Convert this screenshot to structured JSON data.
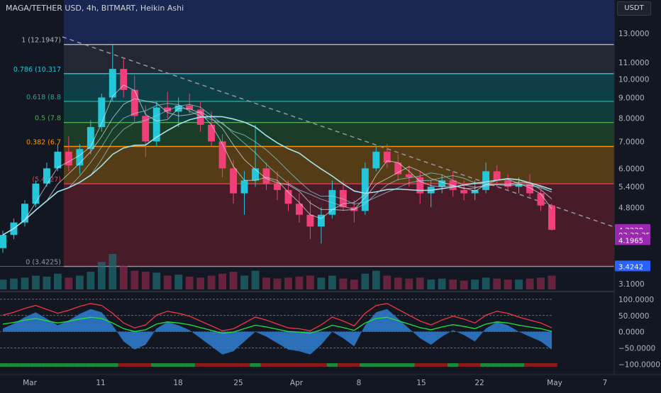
{
  "header": {
    "title": "MAGA/TETHER USD, 4h, BITMART, Heikin Ashi",
    "currency_button": "USDT"
  },
  "chart_data": [
    {
      "type": "candlestick",
      "title": "MAGA/TETHER USD, 4h, BITMART, Heikin Ashi",
      "scale": "log",
      "ylim": [
        3.0,
        14.5
      ],
      "y_ticks": [
        "13.0000",
        "11.0000",
        "10.0000",
        "9.0000",
        "8.0000",
        "7.0000",
        "6.0000",
        "5.4000",
        "4.8000",
        "3.1000"
      ],
      "y_tick_values": [
        13.0,
        11.0,
        10.0,
        9.0,
        8.0,
        7.0,
        6.0,
        5.4,
        4.8,
        3.1
      ],
      "x_ticks": [
        "Mar",
        "11",
        "18",
        "25",
        "Apr",
        "8",
        "15",
        "22",
        "May",
        "7"
      ],
      "fib_levels": [
        {
          "label": "1 (12.1947)",
          "value": 12.1947,
          "color": "#b2b5be"
        },
        {
          "label": "0.786 (10.317",
          "value": 10.317,
          "color": "#26c6da"
        },
        {
          "label": "0.618 (8.8",
          "value": 8.8,
          "color": "#26a69a"
        },
        {
          "label": "0.5 (7.8",
          "value": 7.8,
          "color": "#4caf50"
        },
        {
          "label": "0.382 (6.7",
          "value": 6.8,
          "color": "#ff9800"
        },
        {
          "label": "(5.4927)",
          "value": 5.4927,
          "color": "#f23645"
        },
        {
          "label": "0 (3.4225)",
          "value": 3.4225,
          "color": "#9598a1"
        }
      ],
      "price_labels": [
        {
          "text": "4.2220",
          "value": 4.222,
          "color": "#9c27b0"
        },
        {
          "text": "03:32:35",
          "value": 4.1,
          "color": "#9c27b0"
        },
        {
          "text": "4.1965",
          "value": 3.98,
          "color": "#9c27b0"
        },
        {
          "text": "3.4242",
          "value": 3.4242,
          "color": "#2962ff"
        }
      ],
      "ohlc_approx": [
        [
          3.8,
          4.2,
          3.7,
          4.1
        ],
        [
          4.1,
          4.5,
          4.0,
          4.4
        ],
        [
          4.4,
          5.0,
          4.3,
          4.9
        ],
        [
          4.9,
          5.6,
          4.8,
          5.5
        ],
        [
          5.5,
          6.2,
          5.4,
          6.0
        ],
        [
          6.0,
          6.9,
          5.9,
          6.6
        ],
        [
          6.6,
          7.2,
          5.9,
          6.1
        ],
        [
          6.1,
          6.9,
          5.8,
          6.7
        ],
        [
          6.7,
          7.9,
          6.5,
          7.6
        ],
        [
          7.6,
          9.2,
          7.4,
          9.0
        ],
        [
          9.0,
          12.19,
          8.8,
          10.6
        ],
        [
          10.6,
          11.3,
          9.0,
          9.4
        ],
        [
          9.4,
          10.2,
          7.8,
          8.1
        ],
        [
          8.1,
          8.6,
          6.4,
          7.0
        ],
        [
          7.0,
          8.8,
          6.8,
          8.5
        ],
        [
          8.5,
          9.3,
          8.0,
          8.3
        ],
        [
          8.3,
          9.0,
          7.6,
          8.6
        ],
        [
          8.6,
          9.2,
          8.2,
          8.4
        ],
        [
          8.4,
          8.8,
          7.4,
          7.7
        ],
        [
          7.7,
          8.3,
          6.8,
          7.0
        ],
        [
          7.0,
          7.3,
          5.7,
          6.0
        ],
        [
          6.0,
          6.3,
          4.9,
          5.2
        ],
        [
          5.2,
          5.9,
          4.6,
          5.6
        ],
        [
          5.6,
          7.7,
          5.4,
          6.0
        ],
        [
          6.0,
          6.2,
          5.3,
          5.5
        ],
        [
          5.5,
          5.9,
          5.0,
          5.3
        ],
        [
          5.3,
          5.6,
          4.7,
          4.9
        ],
        [
          4.9,
          5.2,
          4.4,
          4.6
        ],
        [
          4.6,
          5.0,
          4.0,
          4.3
        ],
        [
          4.3,
          4.8,
          3.9,
          4.6
        ],
        [
          4.6,
          5.6,
          4.5,
          5.3
        ],
        [
          5.3,
          5.6,
          4.7,
          4.8
        ],
        [
          4.8,
          5.0,
          4.4,
          4.7
        ],
        [
          4.7,
          6.2,
          4.6,
          6.0
        ],
        [
          6.0,
          6.8,
          5.9,
          6.6
        ],
        [
          6.6,
          6.9,
          6.0,
          6.2
        ],
        [
          6.2,
          6.5,
          5.6,
          5.8
        ],
        [
          5.8,
          6.1,
          5.4,
          5.7
        ],
        [
          5.7,
          5.9,
          4.9,
          5.2
        ],
        [
          5.2,
          5.6,
          4.8,
          5.4
        ],
        [
          5.4,
          5.8,
          5.2,
          5.6
        ],
        [
          5.6,
          5.9,
          5.1,
          5.3
        ],
        [
          5.3,
          5.6,
          5.0,
          5.2
        ],
        [
          5.2,
          5.6,
          5.0,
          5.3
        ],
        [
          5.3,
          6.2,
          5.2,
          5.9
        ],
        [
          5.9,
          6.1,
          5.4,
          5.6
        ],
        [
          5.6,
          5.8,
          5.3,
          5.4
        ],
        [
          5.4,
          5.7,
          5.2,
          5.5
        ],
        [
          5.5,
          5.8,
          5.1,
          5.2
        ],
        [
          5.2,
          5.3,
          4.7,
          4.85
        ],
        [
          4.85,
          4.9,
          4.2,
          4.22
        ]
      ],
      "volume_approx": [
        50,
        55,
        60,
        70,
        65,
        80,
        60,
        70,
        90,
        140,
        180,
        120,
        95,
        90,
        85,
        70,
        75,
        65,
        60,
        70,
        80,
        90,
        70,
        95,
        60,
        55,
        60,
        65,
        70,
        60,
        70,
        55,
        50,
        80,
        95,
        70,
        60,
        55,
        60,
        50,
        55,
        50,
        45,
        50,
        60,
        55,
        50,
        50,
        55,
        60,
        70
      ]
    },
    {
      "type": "oscillator",
      "y_ticks": [
        "100.0000",
        "50.0000",
        "0.0000",
        "−50.0000",
        "−100.0000"
      ],
      "y_tick_values": [
        100,
        50,
        0,
        -50,
        -100
      ],
      "ylim": [
        -110,
        115
      ],
      "wave_approx": [
        10,
        25,
        45,
        60,
        40,
        20,
        35,
        55,
        70,
        60,
        20,
        -30,
        -55,
        -40,
        10,
        30,
        20,
        5,
        -20,
        -45,
        -70,
        -60,
        -30,
        0,
        -15,
        -35,
        -55,
        -60,
        -70,
        -40,
        0,
        -20,
        -45,
        20,
        60,
        70,
        40,
        10,
        -20,
        -40,
        -15,
        5,
        -10,
        -30,
        10,
        30,
        20,
        0,
        -15,
        -30,
        -55
      ]
    }
  ]
}
